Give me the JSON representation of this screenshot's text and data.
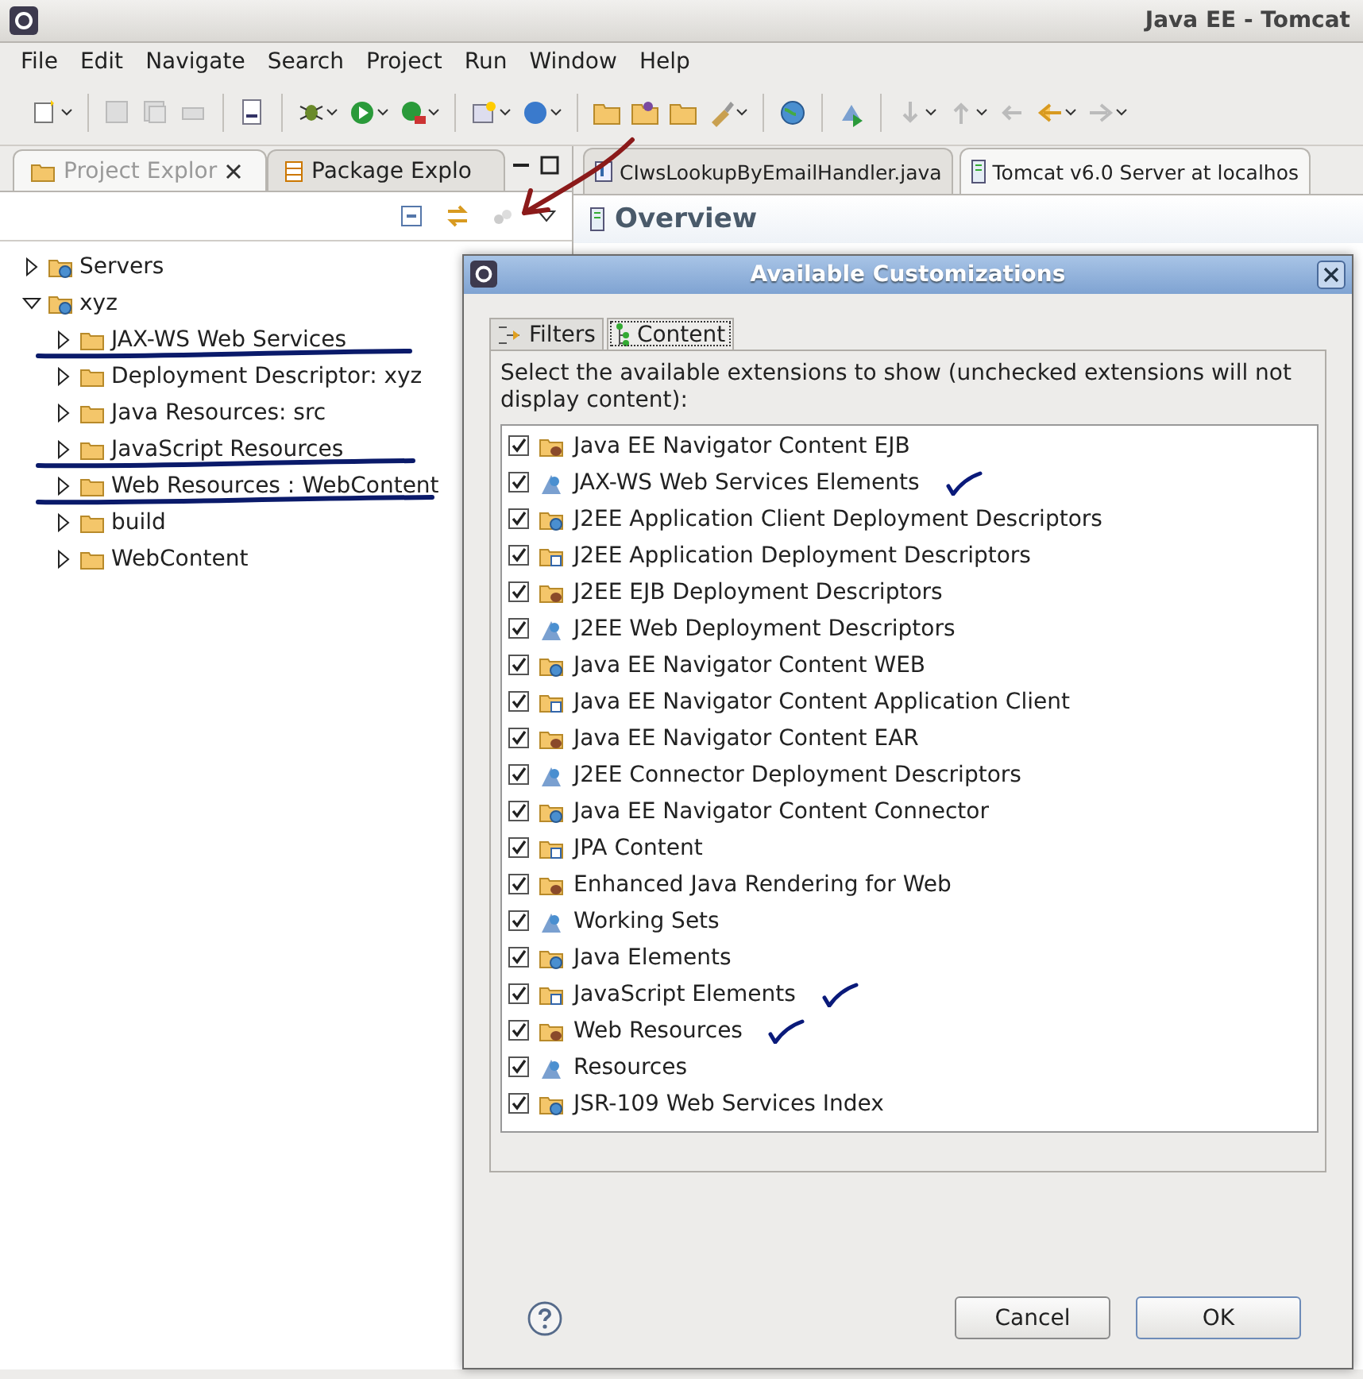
{
  "window": {
    "title": "Java EE - Tomcat"
  },
  "menu": [
    "File",
    "Edit",
    "Navigate",
    "Search",
    "Project",
    "Run",
    "Window",
    "Help"
  ],
  "left_panel": {
    "tabs": [
      {
        "label": "Project Explor",
        "selected": true
      },
      {
        "label": "Package Explo",
        "selected": false
      }
    ],
    "tree": [
      {
        "label": "Servers",
        "expanded": false,
        "struck": false
      },
      {
        "label": "xyz",
        "expanded": true,
        "struck": false,
        "children": [
          {
            "label": "JAX-WS Web Services",
            "expanded": false,
            "struck": true
          },
          {
            "label": "Deployment Descriptor: xyz",
            "expanded": false,
            "struck": false
          },
          {
            "label": "Java Resources: src",
            "expanded": false,
            "struck": false
          },
          {
            "label": "JavaScript Resources",
            "expanded": false,
            "struck": true
          },
          {
            "label": "Web Resources : WebContent",
            "expanded": false,
            "struck": true
          },
          {
            "label": "build",
            "expanded": false,
            "struck": false
          },
          {
            "label": "WebContent",
            "expanded": false,
            "struck": false
          }
        ]
      }
    ]
  },
  "editor": {
    "tabs": [
      {
        "label": "CIwsLookupByEmailHandler.java",
        "selected": false
      },
      {
        "label": "Tomcat v6.0 Server at localhos",
        "selected": true
      }
    ],
    "heading": "Overview"
  },
  "dialog": {
    "title": "Available Customizations",
    "tabs": [
      {
        "label": "Filters",
        "selected": false
      },
      {
        "label": "Content",
        "selected": true
      }
    ],
    "description": "Select the available extensions to show (unchecked extensions will not display content):",
    "items": [
      {
        "label": "Java EE Navigator Content EJB",
        "checked": true,
        "ticked": false
      },
      {
        "label": "JAX-WS Web Services Elements",
        "checked": true,
        "ticked": true
      },
      {
        "label": "J2EE Application Client Deployment Descriptors",
        "checked": true,
        "ticked": false
      },
      {
        "label": "J2EE Application Deployment Descriptors",
        "checked": true,
        "ticked": false
      },
      {
        "label": "J2EE EJB Deployment Descriptors",
        "checked": true,
        "ticked": false
      },
      {
        "label": "J2EE Web Deployment Descriptors",
        "checked": true,
        "ticked": false
      },
      {
        "label": "Java EE Navigator Content WEB",
        "checked": true,
        "ticked": false
      },
      {
        "label": "Java EE Navigator Content Application Client",
        "checked": true,
        "ticked": false
      },
      {
        "label": "Java EE Navigator Content EAR",
        "checked": true,
        "ticked": false
      },
      {
        "label": "J2EE Connector Deployment Descriptors",
        "checked": true,
        "ticked": false
      },
      {
        "label": "Java EE Navigator Content Connector",
        "checked": true,
        "ticked": false
      },
      {
        "label": "JPA Content",
        "checked": true,
        "ticked": false
      },
      {
        "label": "Enhanced Java Rendering for Web",
        "checked": true,
        "ticked": false
      },
      {
        "label": "Working Sets",
        "checked": true,
        "ticked": false
      },
      {
        "label": "Java Elements",
        "checked": true,
        "ticked": false
      },
      {
        "label": "JavaScript Elements",
        "checked": true,
        "ticked": true
      },
      {
        "label": "Web Resources",
        "checked": true,
        "ticked": true
      },
      {
        "label": "Resources",
        "checked": true,
        "ticked": false
      },
      {
        "label": "JSR-109 Web Services Index",
        "checked": true,
        "ticked": false
      }
    ],
    "buttons": [
      {
        "label": "Cancel",
        "default": false
      },
      {
        "label": "OK",
        "default": true
      }
    ]
  }
}
